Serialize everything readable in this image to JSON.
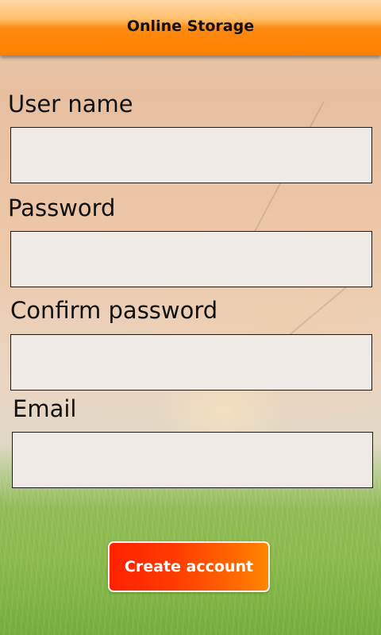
{
  "header": {
    "title": "Online Storage"
  },
  "form": {
    "username": {
      "label": "User name",
      "value": ""
    },
    "password": {
      "label": "Password",
      "value": ""
    },
    "confirm_password": {
      "label": "Confirm password",
      "value": ""
    },
    "email": {
      "label": "Email",
      "value": ""
    }
  },
  "actions": {
    "create_account_label": "Create account"
  },
  "colors": {
    "header_orange": "#ff8000",
    "button_red": "#ff2200",
    "button_orange": "#ff8500",
    "field_background": "#f0eae6"
  }
}
